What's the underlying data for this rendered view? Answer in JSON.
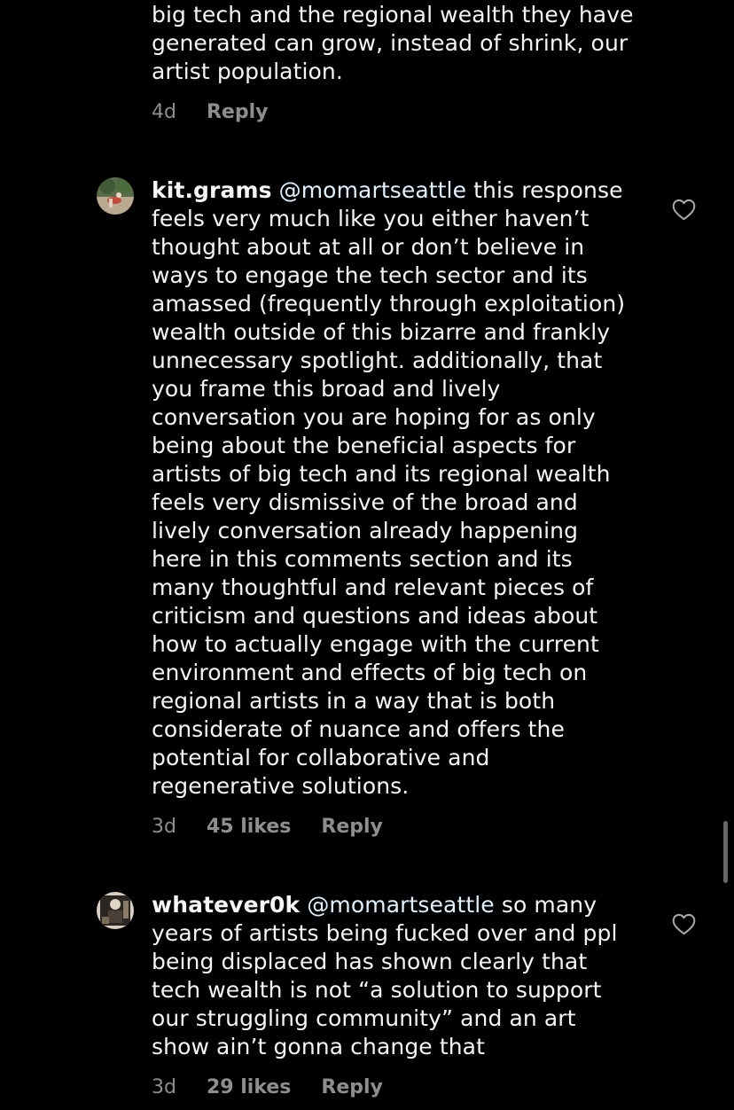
{
  "comments": [
    {
      "id": "prev",
      "text": "big tech and the regional wealth they have\ngenerated can grow, instead of shrink, our\nartist population.",
      "time": "4d",
      "reply_label": "Reply"
    },
    {
      "id": "kit",
      "username": "kit.grams",
      "mention": "@momartseattle",
      "text_first": " this response",
      "text_rest": "feels very much like you either haven’t\nthought about at all or don’t believe in\nways to engage the tech sector and its\namassed (frequently through exploitation)\nwealth outside of this bizarre and frankly\nunnecessary spotlight. additionally, that\nyou frame this broad and lively\nconversation you are hoping for as only\nbeing about the beneficial aspects for\nartists of big tech and its regional wealth\nfeels very dismissive of the broad and\nlively conversation already happening\nhere in this comments section and its\nmany thoughtful and relevant pieces of\ncriticism and questions and ideas about\nhow to actually engage with the current\nenvironment and effects of big tech on\nregional artists in a way that is both\nconsiderate of nuance and offers the\npotential for collaborative and\nregenerative solutions.",
      "time": "3d",
      "likes": "45 likes",
      "reply_label": "Reply",
      "avatar_icon": "user-avatar-photo",
      "like_icon": "heart-outline-icon"
    },
    {
      "id": "whatever",
      "username": "whatever0k",
      "mention": "@momartseattle",
      "text_first": " so many",
      "text_rest": "years of artists being fucked over and ppl\nbeing displaced has shown clearly that\ntech wealth is not “a solution to support\nour struggling community” and an art\nshow ain’t gonna change that",
      "time": "3d",
      "likes": "29 likes",
      "reply_label": "Reply",
      "avatar_icon": "user-avatar-photo",
      "like_icon": "heart-outline-icon"
    }
  ],
  "colors": {
    "background": "#000000",
    "text": "#f5f5f5",
    "mention": "#e0f1ff",
    "meta": "#8e8e8e"
  }
}
